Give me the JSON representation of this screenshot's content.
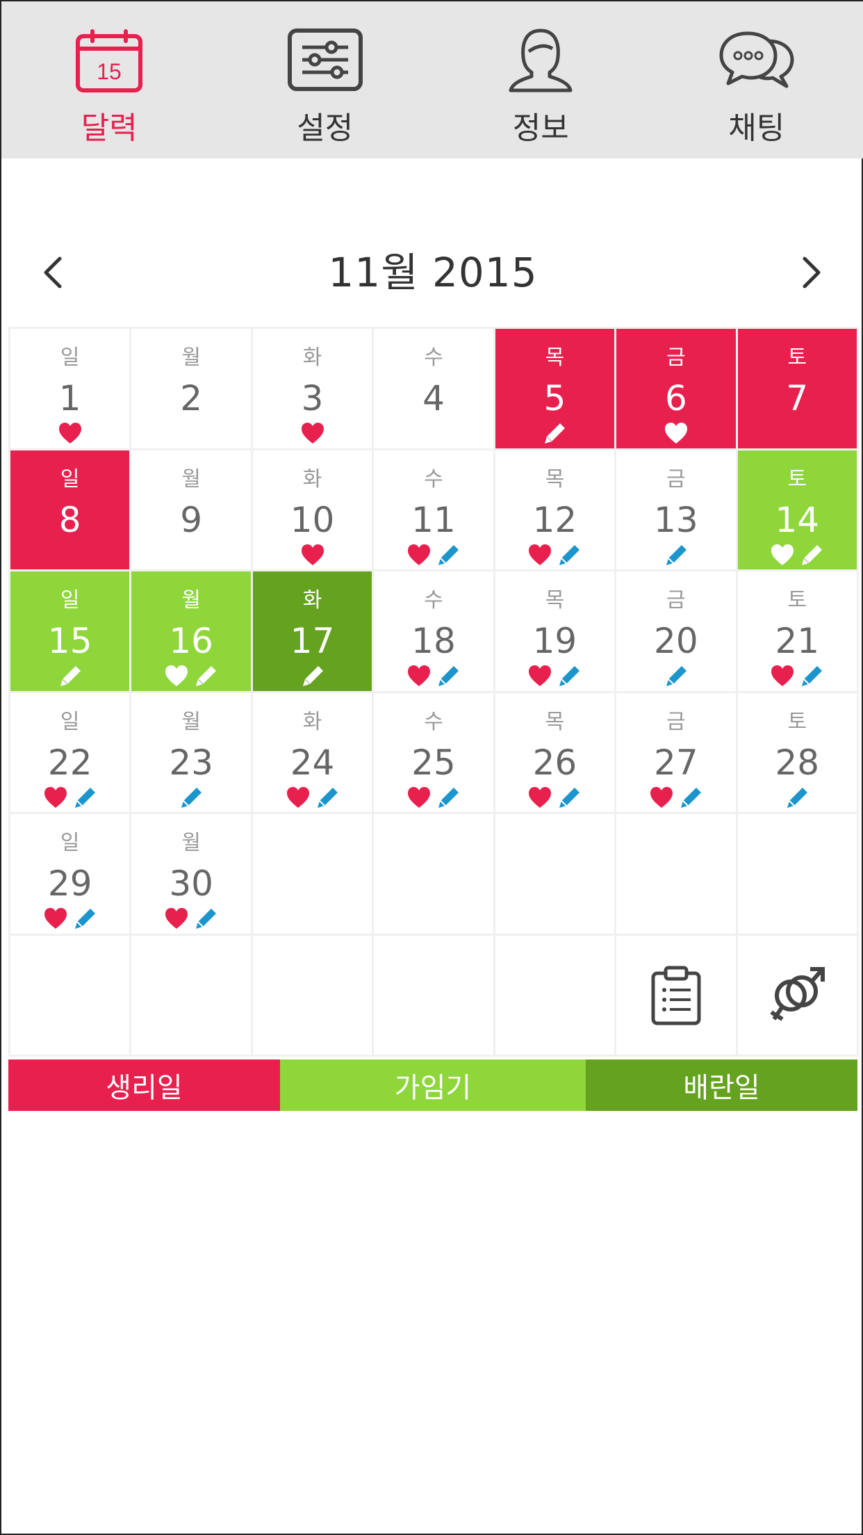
{
  "nav": {
    "tabs": [
      {
        "label": "달력",
        "icon": "calendar-icon",
        "active": true,
        "icon_day": "15"
      },
      {
        "label": "설정",
        "icon": "sliders-icon",
        "active": false
      },
      {
        "label": "정보",
        "icon": "person-icon",
        "active": false
      },
      {
        "label": "채팅",
        "icon": "chat-bubbles-icon",
        "active": false
      }
    ]
  },
  "calendar": {
    "title": "11월 2015",
    "prev_icon": "chevron-left-icon",
    "next_icon": "chevron-right-icon",
    "days": [
      {
        "wd": "일",
        "d": "1",
        "state": "",
        "marks": [
          "heart-red"
        ]
      },
      {
        "wd": "월",
        "d": "2",
        "state": "",
        "marks": []
      },
      {
        "wd": "화",
        "d": "3",
        "state": "",
        "marks": [
          "heart-red"
        ]
      },
      {
        "wd": "수",
        "d": "4",
        "state": "",
        "marks": []
      },
      {
        "wd": "목",
        "d": "5",
        "state": "period",
        "marks": [
          "pencil-white"
        ]
      },
      {
        "wd": "금",
        "d": "6",
        "state": "period",
        "marks": [
          "heart-white"
        ]
      },
      {
        "wd": "토",
        "d": "7",
        "state": "period",
        "marks": []
      },
      {
        "wd": "일",
        "d": "8",
        "state": "period",
        "marks": []
      },
      {
        "wd": "월",
        "d": "9",
        "state": "",
        "marks": []
      },
      {
        "wd": "화",
        "d": "10",
        "state": "",
        "marks": [
          "heart-red"
        ]
      },
      {
        "wd": "수",
        "d": "11",
        "state": "",
        "marks": [
          "heart-red",
          "pencil-blue"
        ]
      },
      {
        "wd": "목",
        "d": "12",
        "state": "",
        "marks": [
          "heart-red",
          "pencil-blue"
        ]
      },
      {
        "wd": "금",
        "d": "13",
        "state": "",
        "marks": [
          "pencil-blue"
        ]
      },
      {
        "wd": "토",
        "d": "14",
        "state": "fertile",
        "marks": [
          "heart-white",
          "pencil-white"
        ]
      },
      {
        "wd": "일",
        "d": "15",
        "state": "fertile",
        "marks": [
          "pencil-white"
        ]
      },
      {
        "wd": "월",
        "d": "16",
        "state": "fertile",
        "marks": [
          "heart-white",
          "pencil-white"
        ]
      },
      {
        "wd": "화",
        "d": "17",
        "state": "ovulation",
        "marks": [
          "pencil-white"
        ]
      },
      {
        "wd": "수",
        "d": "18",
        "state": "",
        "marks": [
          "heart-red",
          "pencil-blue"
        ]
      },
      {
        "wd": "목",
        "d": "19",
        "state": "",
        "marks": [
          "heart-red",
          "pencil-blue"
        ]
      },
      {
        "wd": "금",
        "d": "20",
        "state": "",
        "marks": [
          "pencil-blue"
        ]
      },
      {
        "wd": "토",
        "d": "21",
        "state": "",
        "marks": [
          "heart-red",
          "pencil-blue"
        ]
      },
      {
        "wd": "일",
        "d": "22",
        "state": "",
        "marks": [
          "heart-red",
          "pencil-blue"
        ]
      },
      {
        "wd": "월",
        "d": "23",
        "state": "",
        "marks": [
          "pencil-blue"
        ]
      },
      {
        "wd": "화",
        "d": "24",
        "state": "",
        "marks": [
          "heart-red",
          "pencil-blue"
        ]
      },
      {
        "wd": "수",
        "d": "25",
        "state": "",
        "marks": [
          "heart-red",
          "pencil-blue"
        ]
      },
      {
        "wd": "목",
        "d": "26",
        "state": "",
        "marks": [
          "heart-red",
          "pencil-blue"
        ]
      },
      {
        "wd": "금",
        "d": "27",
        "state": "",
        "marks": [
          "heart-red",
          "pencil-blue"
        ]
      },
      {
        "wd": "토",
        "d": "28",
        "state": "",
        "marks": [
          "pencil-blue"
        ]
      },
      {
        "wd": "일",
        "d": "29",
        "state": "",
        "marks": [
          "heart-red",
          "pencil-blue"
        ]
      },
      {
        "wd": "월",
        "d": "30",
        "state": "",
        "marks": [
          "heart-red",
          "pencil-blue"
        ]
      }
    ],
    "tools": [
      {
        "icon": "clipboard-list-icon"
      },
      {
        "icon": "gender-symbol-icon"
      }
    ]
  },
  "legend": [
    {
      "label": "생리일",
      "color": "#e8204e"
    },
    {
      "label": "가임기",
      "color": "#8ed63a"
    },
    {
      "label": "배란일",
      "color": "#64a21f"
    }
  ],
  "colors": {
    "accent": "#e8204e",
    "period": "#e8204e",
    "fertile": "#8ed63a",
    "ovulation": "#64a21f",
    "pencil_blue": "#1b95cc"
  }
}
